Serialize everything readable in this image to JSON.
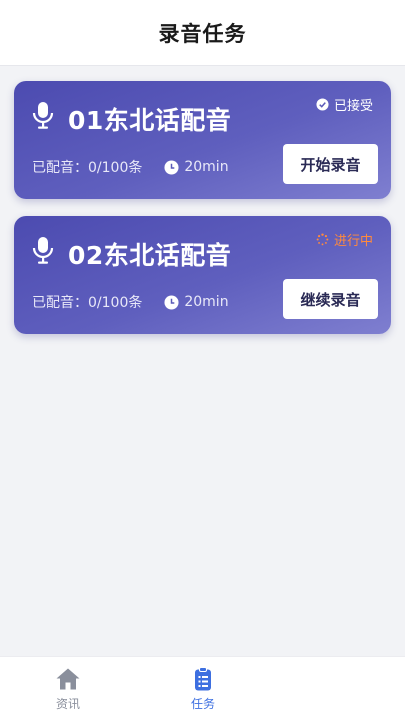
{
  "header": {
    "title": "录音任务"
  },
  "tasks": [
    {
      "name": "01东北话配音",
      "status": "已接受",
      "status_type": "accepted",
      "progress_text": "已配音：0/100条",
      "duration": "20min",
      "button_label": "开始录音"
    },
    {
      "name": "02东北话配音",
      "status": "进行中",
      "status_type": "in-progress",
      "progress_text": "已配音：0/100条",
      "duration": "20min",
      "button_label": "继续录音"
    }
  ],
  "tabbar": {
    "items": [
      {
        "label": "资讯",
        "icon": "home-icon",
        "active": false
      },
      {
        "label": "任务",
        "icon": "clipboard-icon",
        "active": true
      }
    ]
  },
  "colors": {
    "card_gradient_start": "#4c4bb0",
    "card_gradient_end": "#7f7fd0",
    "status_progress": "#ff8a3d",
    "tab_active": "#3d6fe0",
    "tab_inactive": "#8a8f9c"
  }
}
